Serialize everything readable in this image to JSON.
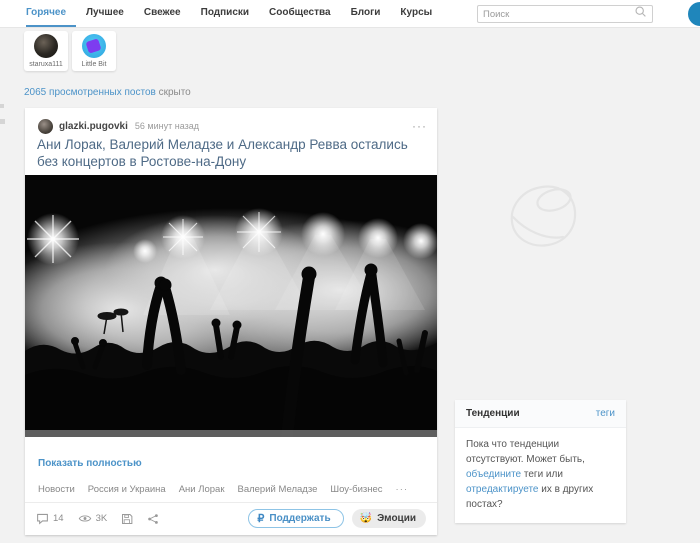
{
  "nav": {
    "tabs": [
      {
        "label": "Горячее",
        "active": true
      },
      {
        "label": "Лучшее",
        "active": false
      },
      {
        "label": "Свежее",
        "active": false
      },
      {
        "label": "Подписки",
        "active": false
      },
      {
        "label": "Сообщества",
        "active": false
      },
      {
        "label": "Блоги",
        "active": false
      },
      {
        "label": "Курсы",
        "active": false
      }
    ],
    "search_placeholder": "Поиск"
  },
  "stories": [
    {
      "name": "staruxa111"
    },
    {
      "name": "Little Bit"
    }
  ],
  "hidden": {
    "link_text": "2065 просмотренных постов",
    "suffix": " скрыто"
  },
  "post": {
    "author": "glazki.pugovki",
    "time": "56 минут назад",
    "menu_dots": "···",
    "title": "Ани Лорак, Валерий Меладзе и Александр Ревва остались без концертов в Ростове-на-Дону",
    "show_full": "Показать полностью",
    "tags": [
      "Новости",
      "Россия и Украина",
      "Ани Лорак",
      "Валерий Меладзе",
      "Шоу-бизнес"
    ],
    "more_tags": "···",
    "stats": {
      "comments": "14",
      "views": "3K"
    },
    "buttons": {
      "support_icon": "₽",
      "support_label": "Поддержать",
      "emotions_emoji": "🤯",
      "emotions_label": "Эмоции"
    }
  },
  "trends": {
    "title": "Тенденции",
    "tags_link": "теги",
    "text_1": "Пока что тенденции отсутствуют. Может быть, ",
    "link_1": "объедините",
    "text_2": " теги или ",
    "link_2": "отредактируете",
    "text_3": " их в других постах?"
  },
  "colors": {
    "accent_blue": "#4c93c8",
    "title_blue_gray": "#4e6a86",
    "page_bg": "#f2f2f2",
    "profile_circle": "#1f86bb",
    "support_border": "#8ec4e6"
  }
}
